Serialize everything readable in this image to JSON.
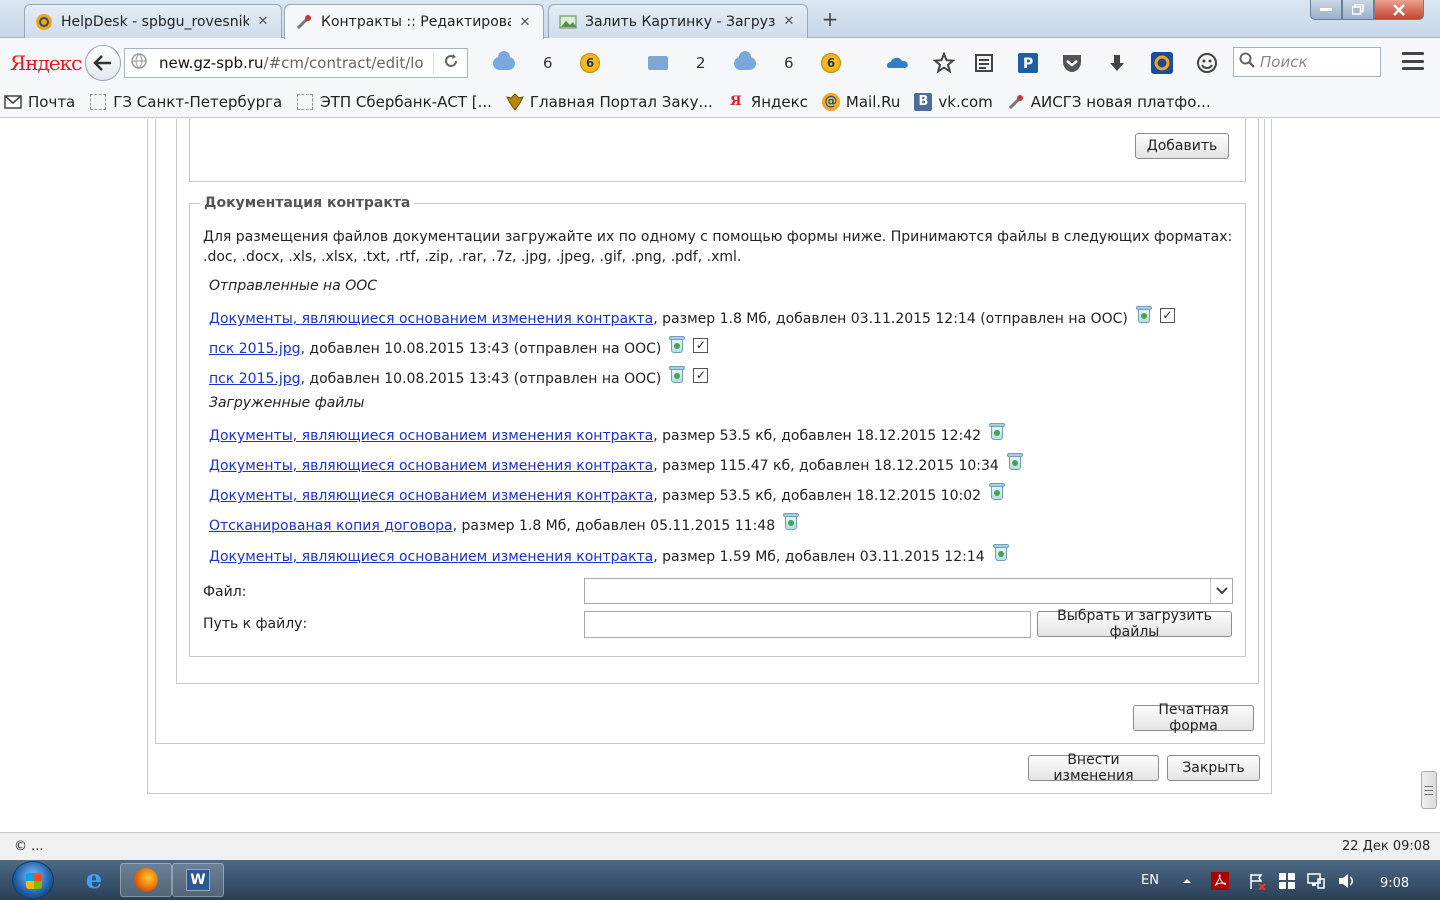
{
  "browser": {
    "tabs": [
      {
        "title": "HelpDesk - spbgu_rovesnik...",
        "icon": "mail-ru-icon",
        "active": false
      },
      {
        "title": "Контракты :: Редактирова...",
        "icon": "tools-icon",
        "active": true
      },
      {
        "title": "Залить Картинку - Загруз...",
        "icon": "image-icon",
        "active": false
      }
    ],
    "close_glyph": "✕",
    "new_tab_glyph": "+",
    "logo": "Яндекс",
    "url_domain": "new.gz-spb.ru",
    "url_path": "/#cm/contract/edit/lo",
    "toolbar_counters": [
      "6",
      "2",
      "6"
    ],
    "coin_label": "6",
    "search_placeholder": "Поиск",
    "bookmarks": [
      {
        "label": "Почта",
        "icon": "mail-envelope-icon"
      },
      {
        "label": "ГЗ Санкт-Петербурга",
        "icon": "placeholder-icon"
      },
      {
        "label": "ЭТП Сбербанк-АСТ [...",
        "icon": "placeholder-icon"
      },
      {
        "label": "Главная Портал Заку...",
        "icon": "coat-of-arms-icon"
      },
      {
        "label": "Яндекс",
        "icon": "yandex-icon"
      },
      {
        "label": "Mail.Ru",
        "icon": "mail-ru-icon"
      },
      {
        "label": "vk.com",
        "icon": "vk-icon"
      },
      {
        "label": "АИСГЗ новая платфо...",
        "icon": "tools-icon"
      }
    ]
  },
  "page": {
    "add_button": "Добавить",
    "docs": {
      "legend": "Документация контракта",
      "description": "Для размещения файлов документации загружайте их по одному с помощью формы ниже. Принимаются файлы в следующих форматах: .doc, .docx, .xls, .xlsx, .txt, .rtf, .zip, .rar, .7z, .jpg, .jpeg, .gif, .png, .pdf, .xml.",
      "sent_title": "Отправленные на ООС",
      "sent_files": [
        {
          "link": "Документы, являющиеся основанием изменения контракта",
          "info": ", размер 1.8 Мб, добавлен 03.11.2015 12:14 (отправлен на ООС)",
          "checked": true
        },
        {
          "link": "пск 2015.jpg",
          "info": ", добавлен 10.08.2015 13:43 (отправлен на ООС)",
          "checked": true
        },
        {
          "link": "пск 2015.jpg",
          "info": ", добавлен 10.08.2015 13:43 (отправлен на ООС)",
          "checked": true
        }
      ],
      "uploaded_title": "Загруженные файлы",
      "uploaded_files": [
        {
          "link": "Документы, являющиеся основанием изменения контракта",
          "info": ", размер 53.5 кб, добавлен 18.12.2015 12:42"
        },
        {
          "link": "Документы, являющиеся основанием изменения контракта",
          "info": ", размер 115.47 кб, добавлен 18.12.2015 10:34"
        },
        {
          "link": "Документы, являющиеся основанием изменения контракта",
          "info": ", размер 53.5 кб, добавлен 18.12.2015 10:02"
        },
        {
          "link": "Отсканированая копия договора",
          "info": ", размер 1.8 Мб, добавлен 05.11.2015 11:48"
        },
        {
          "link": "Документы, являющиеся основанием изменения контракта",
          "info": ", размер 1.59 Мб, добавлен 03.11.2015 12:14"
        }
      ],
      "file_label": "Файл:",
      "file_value": "",
      "path_label": "Путь к файлу:",
      "path_value": "",
      "upload_button": "Выбрать и загрузить файлы"
    },
    "print_button": "Печатная форма",
    "apply_button": "Внести изменения",
    "close_button": "Закрыть"
  },
  "statusbar": {
    "left": "© ...",
    "right": "22 Дек 09:08"
  },
  "taskbar": {
    "lang": "EN",
    "time": "9:08"
  }
}
